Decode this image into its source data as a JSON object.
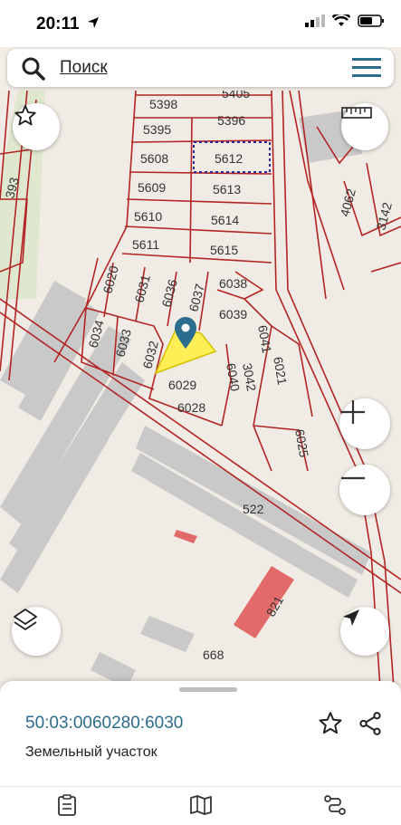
{
  "status_bar": {
    "time": "20:11"
  },
  "search": {
    "label": "Поиск"
  },
  "map": {
    "parcels": [
      "5398",
      "5405",
      "5395",
      "5396",
      "5608",
      "5612",
      "5609",
      "5613",
      "5610",
      "5614",
      "5611",
      "5615",
      "6020",
      "6031",
      "6036",
      "6037",
      "6038",
      "6039",
      "6034",
      "6033",
      "6032",
      "6029",
      "6028",
      "6040",
      "6041",
      "3042",
      "6021",
      "6025",
      "522",
      "821",
      "668",
      "4062",
      "3142",
      "393"
    ],
    "selected_color": "#ffee55",
    "boundary_color": "#b32424"
  },
  "parcel_card": {
    "cadastral_number": "50:03:0060280:6030",
    "object_type": "Земельный участок"
  },
  "tabs": [
    {
      "icon": "clipboard-icon"
    },
    {
      "icon": "map-icon"
    },
    {
      "icon": "route-icon"
    }
  ]
}
